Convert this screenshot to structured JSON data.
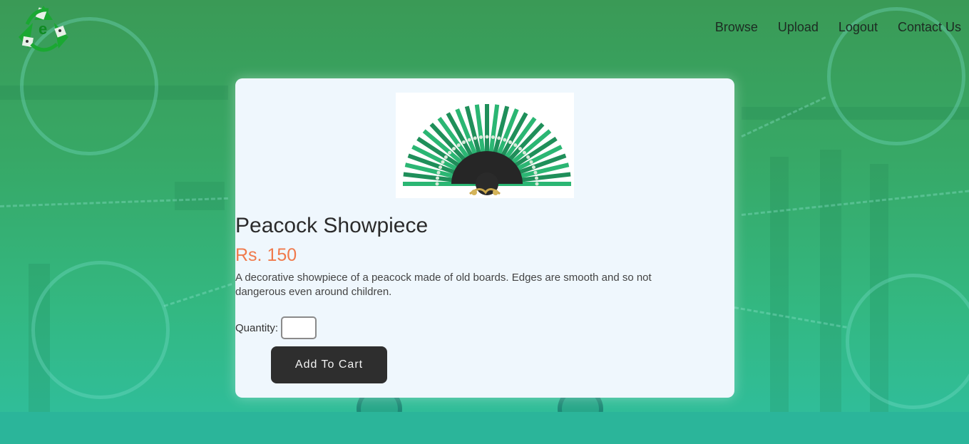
{
  "header": {
    "logo_icon": "recycle-logo-icon",
    "logo_letter": "e",
    "nav": [
      {
        "label": "Browse"
      },
      {
        "label": "Upload"
      },
      {
        "label": "Logout"
      },
      {
        "label": "Contact Us"
      }
    ]
  },
  "product": {
    "image_icon": "peacock-fan-image",
    "title": "Peacock Showpiece",
    "price": "Rs. 150",
    "description": "A decorative showpiece of a peacock made of old boards. Edges are smooth and so not dangerous even around children.",
    "quantity_label": "Quantity:",
    "quantity_value": "",
    "add_to_cart_label": "Add To Cart"
  },
  "colors": {
    "price": "#f07a4c",
    "button_bg": "#2e2e2e",
    "card_bg": "#eff7fd",
    "bg_green": "#37a866"
  }
}
